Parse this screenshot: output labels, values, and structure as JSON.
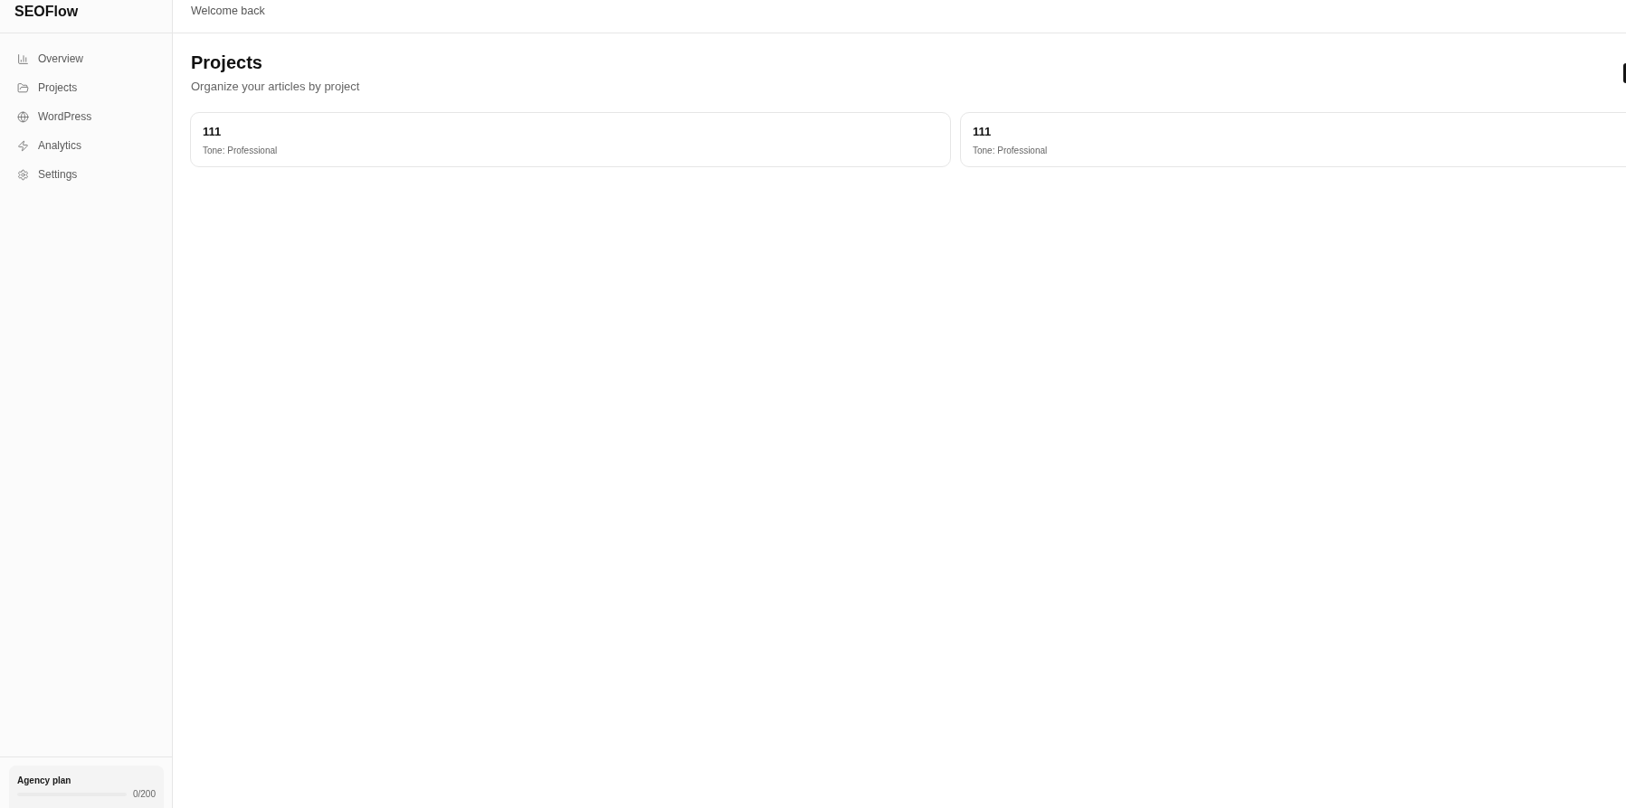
{
  "sidebar": {
    "brand": "SEOFlow",
    "nav_items": [
      {
        "label": "Overview",
        "selected": false
      },
      {
        "label": "Projects",
        "selected": false
      },
      {
        "label": "WordPress",
        "selected": false
      },
      {
        "label": "Analytics",
        "selected": false
      },
      {
        "label": "Settings",
        "selected": false
      }
    ],
    "plan": {
      "name": "Agency plan",
      "usage": "0/200"
    }
  },
  "header": {
    "greeting": "Welcome back"
  },
  "page": {
    "title": "Projects",
    "subtitle": "Organize your articles by project"
  },
  "projects": [
    {
      "name": "111",
      "tone": "Tone: Professional"
    },
    {
      "name": "111",
      "tone": "Tone: Professional"
    }
  ]
}
